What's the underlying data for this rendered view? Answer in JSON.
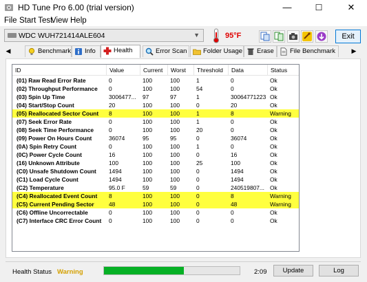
{
  "window": {
    "title": "HD Tune Pro 6.00 (trial version)",
    "min_glyph": "—",
    "max_glyph": "☐",
    "close_glyph": "✕"
  },
  "menu": [
    {
      "label": "File"
    },
    {
      "label": "Start Test"
    },
    {
      "label": "View"
    },
    {
      "label": "Help"
    }
  ],
  "toolbar": {
    "drive": "WDC  WUH721414ALE604",
    "temperature": "95°F",
    "exit_label": "Exit"
  },
  "tabs": [
    {
      "label": "Benchmark",
      "icon": "lightbulb-icon"
    },
    {
      "label": "Info",
      "icon": "info-icon"
    },
    {
      "label": "Health",
      "icon": "health-cross-icon",
      "active": true
    },
    {
      "label": "Error Scan",
      "icon": "magnifier-icon"
    },
    {
      "label": "Folder Usage",
      "icon": "folder-icon"
    },
    {
      "label": "Erase",
      "icon": "trash-icon"
    },
    {
      "label": "File Benchmark",
      "icon": "file-icon"
    }
  ],
  "table": {
    "columns": [
      "ID",
      "Value",
      "Current",
      "Worst",
      "Threshold",
      "Data",
      "Status"
    ],
    "rows": [
      {
        "id": "(01) Raw Read Error Rate",
        "value": "0",
        "current": "100",
        "worst": "100",
        "threshold": "1",
        "data": "0",
        "status": "Ok",
        "warn": false
      },
      {
        "id": "(02) Throughput Performance",
        "value": "0",
        "current": "100",
        "worst": "100",
        "threshold": "54",
        "data": "0",
        "status": "Ok",
        "warn": false
      },
      {
        "id": "(03) Spin Up Time",
        "value": "3006477...",
        "current": "97",
        "worst": "97",
        "threshold": "1",
        "data": "30064771223",
        "status": "Ok",
        "warn": false
      },
      {
        "id": "(04) Start/Stop Count",
        "value": "20",
        "current": "100",
        "worst": "100",
        "threshold": "0",
        "data": "20",
        "status": "Ok",
        "warn": false
      },
      {
        "id": "(05) Reallocated Sector Count",
        "value": "8",
        "current": "100",
        "worst": "100",
        "threshold": "1",
        "data": "8",
        "status": "Warning",
        "warn": true
      },
      {
        "id": "(07) Seek Error Rate",
        "value": "0",
        "current": "100",
        "worst": "100",
        "threshold": "1",
        "data": "0",
        "status": "Ok",
        "warn": false
      },
      {
        "id": "(08) Seek Time Performance",
        "value": "0",
        "current": "100",
        "worst": "100",
        "threshold": "20",
        "data": "0",
        "status": "Ok",
        "warn": false
      },
      {
        "id": "(09) Power On Hours Count",
        "value": "36074",
        "current": "95",
        "worst": "95",
        "threshold": "0",
        "data": "36074",
        "status": "Ok",
        "warn": false
      },
      {
        "id": "(0A) Spin Retry Count",
        "value": "0",
        "current": "100",
        "worst": "100",
        "threshold": "1",
        "data": "0",
        "status": "Ok",
        "warn": false
      },
      {
        "id": "(0C) Power Cycle Count",
        "value": "16",
        "current": "100",
        "worst": "100",
        "threshold": "0",
        "data": "16",
        "status": "Ok",
        "warn": false
      },
      {
        "id": "(16) Unknown Attribute",
        "value": "100",
        "current": "100",
        "worst": "100",
        "threshold": "25",
        "data": "100",
        "status": "Ok",
        "warn": false
      },
      {
        "id": "(C0) Unsafe Shutdown Count",
        "value": "1494",
        "current": "100",
        "worst": "100",
        "threshold": "0",
        "data": "1494",
        "status": "Ok",
        "warn": false
      },
      {
        "id": "(C1) Load Cycle Count",
        "value": "1494",
        "current": "100",
        "worst": "100",
        "threshold": "0",
        "data": "1494",
        "status": "Ok",
        "warn": false
      },
      {
        "id": "(C2) Temperature",
        "value": "95.0 F",
        "current": "59",
        "worst": "59",
        "threshold": "0",
        "data": "240519807...",
        "status": "Ok",
        "warn": false
      },
      {
        "id": "(C4) Reallocated Event Count",
        "value": "8",
        "current": "100",
        "worst": "100",
        "threshold": "0",
        "data": "8",
        "status": "Warning",
        "warn": true
      },
      {
        "id": "(C5) Current Pending Sector",
        "value": "48",
        "current": "100",
        "worst": "100",
        "threshold": "0",
        "data": "48",
        "status": "Warning",
        "warn": true
      },
      {
        "id": "(C6) Offline Uncorrectable",
        "value": "0",
        "current": "100",
        "worst": "100",
        "threshold": "0",
        "data": "0",
        "status": "Ok",
        "warn": false
      },
      {
        "id": "(C7) Interface CRC Error Count",
        "value": "0",
        "current": "100",
        "worst": "100",
        "threshold": "0",
        "data": "0",
        "status": "Ok",
        "warn": false
      }
    ]
  },
  "status": {
    "health_label": "Health Status",
    "health_value": "Warning",
    "progress_fraction": 0.59,
    "progress_color": "#06b025",
    "time": "2:09",
    "update_label": "Update",
    "log_label": "Log"
  },
  "colors": {
    "warning_row": "#ffff3f",
    "temperature": "#e00000",
    "health_warning": "#d4a000"
  }
}
